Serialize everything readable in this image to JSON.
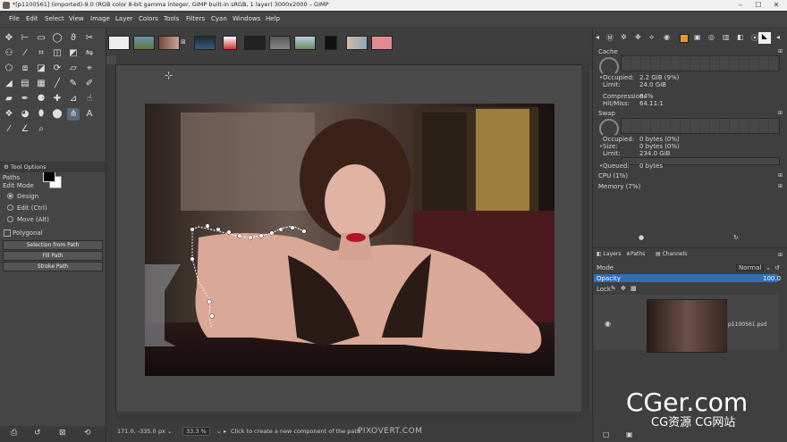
{
  "window": {
    "title": "*[p1100561] (imported)-9.0 (RGB color 8-bit gamma integer, GIMP built-in sRGB, 1 layer) 3000x2000 – GIMP",
    "controls": [
      "–",
      "☐",
      "✕"
    ]
  },
  "menu": [
    "File",
    "Edit",
    "Select",
    "View",
    "Image",
    "Layer",
    "Colors",
    "Tools",
    "Filters",
    "Cyan",
    "Windows",
    "Help"
  ],
  "tool_options": {
    "title": "Tool Options",
    "section": "Paths",
    "edit_mode_label": "Edit Mode",
    "modes": [
      "Design",
      "Edit (Ctrl)",
      "Move (Alt)"
    ],
    "selected_mode": "Design",
    "polygonal_label": "Polygonal",
    "buttons": [
      "Selection from Path",
      "Fill Path",
      "Stroke Path"
    ]
  },
  "canvas": {
    "cursor_pos": "171.0, -335.0",
    "unit": "px",
    "zoom": "33.3 %",
    "status_message": "Click to create a new component of the path"
  },
  "dashboard": {
    "cache_label": "Cache",
    "occupied_label": "Occupied:",
    "occupied_value": "2.2 GiB (9%)",
    "limit_label": "Limit:",
    "limit_value": "24.0 GiB",
    "compression_label": "Compression:",
    "compression_value": "84%",
    "hitmiss_label": "Hit/Miss:",
    "hitmiss_value": "64.11:1",
    "swap_label": "Swap",
    "swap_occupied_value": "0 bytes (0%)",
    "size_label": "Size:",
    "size_value": "0 bytes (0%)",
    "swap_limit_value": "234.0 GiB",
    "queued_label": "Queued:",
    "queued_value": "0 bytes",
    "cpu_label": "CPU (1%)",
    "memory_label": "Memory (7%)"
  },
  "layers_panel": {
    "tabs": [
      "Layers",
      "Paths",
      "Channels"
    ],
    "mode_label": "Mode",
    "mode_value": "Normal",
    "opacity_label": "Opacity",
    "opacity_value": "100.0",
    "lock_label": "Lock:",
    "layer_name": "p1100561.psd"
  },
  "watermark": {
    "site": "CGer.com",
    "tagline": "CG资源  CG网站",
    "pixovert": "PIXOVERT.COM"
  },
  "colors": {
    "ui_bg": "#3c3c3c",
    "panel_bg": "#454545",
    "accent_blue": "#2f6fb5"
  }
}
